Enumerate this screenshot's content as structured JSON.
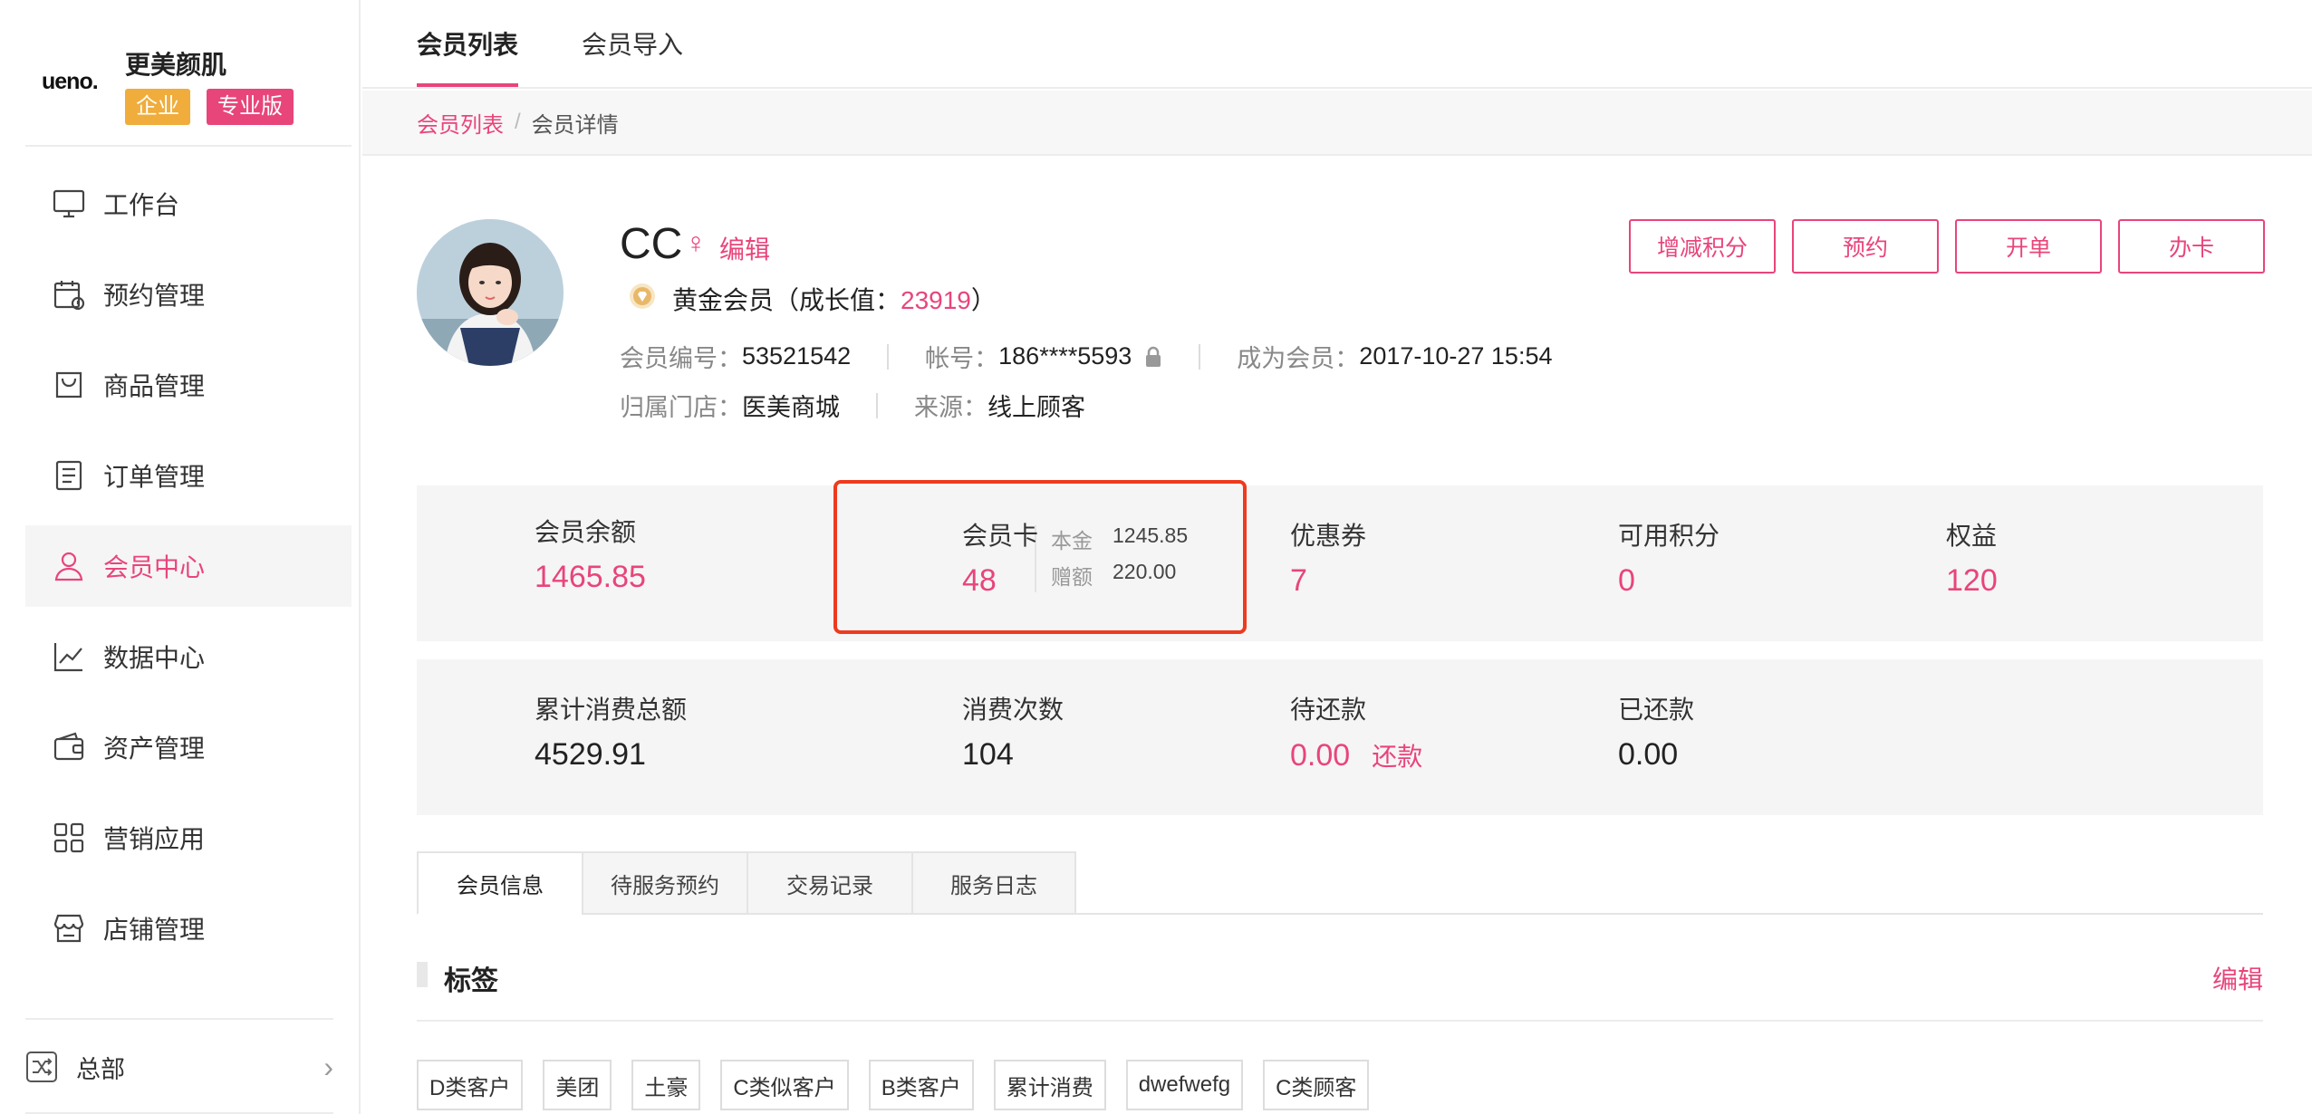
{
  "brand": {
    "logo": "ueno.",
    "name": "更美颜肌",
    "badge_enterprise": "企业",
    "badge_pro": "专业版"
  },
  "nav": {
    "items": [
      {
        "label": "工作台",
        "icon": "monitor-icon"
      },
      {
        "label": "预约管理",
        "icon": "calendar-clock-icon"
      },
      {
        "label": "商品管理",
        "icon": "shopping-bag-icon"
      },
      {
        "label": "订单管理",
        "icon": "document-list-icon"
      },
      {
        "label": "会员中心",
        "icon": "user-icon",
        "active": true
      },
      {
        "label": "数据中心",
        "icon": "line-chart-icon"
      },
      {
        "label": "资产管理",
        "icon": "wallet-icon"
      },
      {
        "label": "营销应用",
        "icon": "grid-apps-icon"
      },
      {
        "label": "店铺管理",
        "icon": "store-icon"
      }
    ],
    "org": "总部"
  },
  "top_tabs": [
    {
      "label": "会员列表",
      "active": true
    },
    {
      "label": "会员导入"
    }
  ],
  "breadcrumb": {
    "link": "会员列表",
    "sep": "/",
    "current": "会员详情"
  },
  "profile": {
    "name": "CC",
    "gender": "♀",
    "edit": "编辑",
    "level_prefix": "黄金会员（成长值：",
    "growth_value": "23919",
    "level_suffix": "）",
    "member_no_label": "会员编号：",
    "member_no": "53521542",
    "account_label": "帐号：",
    "account": "186****5593",
    "joined_label": "成为会员：",
    "joined": "2017-10-27 15:54",
    "store_label": "归属门店：",
    "store": "医美商城",
    "source_label": "来源：",
    "source": "线上顾客"
  },
  "actions": {
    "points": "增减积分",
    "booking": "预约",
    "order": "开单",
    "card": "办卡"
  },
  "stats_row1": {
    "balance_label": "会员余额",
    "balance": "1465.85",
    "principal_label": "本金",
    "principal": "1245.85",
    "bonus_label": "赠额",
    "bonus": "220.00",
    "card_label": "会员卡",
    "card": "48",
    "coupon_label": "优惠券",
    "coupon": "7",
    "points_label": "可用积分",
    "points": "0",
    "rights_label": "权益",
    "rights": "120"
  },
  "stats_row2": {
    "total_label": "累计消费总额",
    "total": "4529.91",
    "count_label": "消费次数",
    "count": "104",
    "due_label": "待还款",
    "due": "0.00",
    "repay": "还款",
    "repaid_label": "已还款",
    "repaid": "0.00"
  },
  "content_tabs": [
    "会员信息",
    "待服务预约",
    "交易记录",
    "服务日志"
  ],
  "tags_section": {
    "title": "标签",
    "edit": "编辑",
    "tags": [
      "D类客户",
      "美团",
      "土豪",
      "C类似客户",
      "B类客户",
      "累计消费",
      "dwefwefg",
      "C类顾客"
    ]
  },
  "colors": {
    "accent": "#e8457a",
    "badge_enterprise": "#f0ad3c",
    "highlight": "#ee3a1f"
  }
}
